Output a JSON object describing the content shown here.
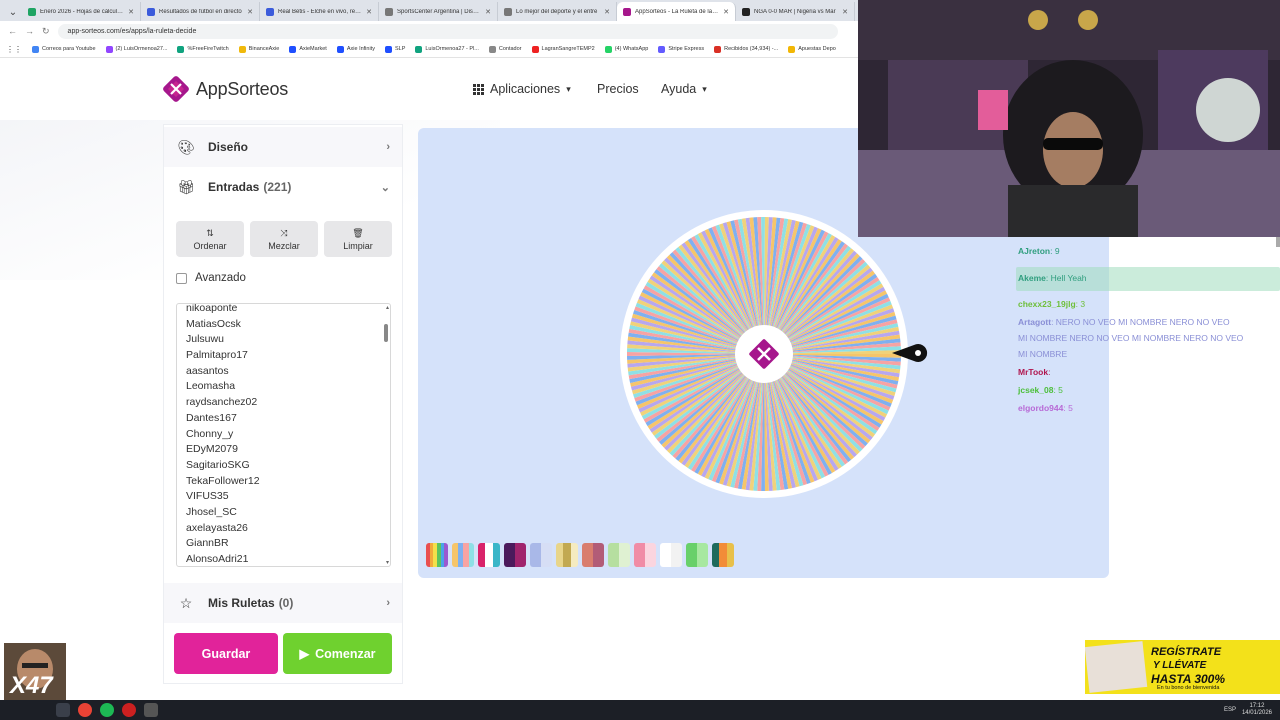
{
  "browser": {
    "tabs": [
      {
        "title": "Enero 2026 - Hojas de cálculo de",
        "color": "#1fa463",
        "active": false
      },
      {
        "title": "Resultados de fútbol en directo",
        "color": "#3b5bdb",
        "active": false
      },
      {
        "title": "Real Betis - Elche en vivo, resulta",
        "color": "#3b5bdb",
        "active": false
      },
      {
        "title": "SportsCenter Argentina | Disney",
        "color": "#777777",
        "active": false
      },
      {
        "title": "Lo mejor del deporte y el entre",
        "color": "#777777",
        "active": false
      },
      {
        "title": "AppSorteos - La Ruleta de la Su",
        "color": "#a6178c",
        "active": true
      },
      {
        "title": "NGA 0-0 MAR | Nigeria vs Mar",
        "color": "#222222",
        "active": false
      }
    ],
    "url": "app-sorteos.com/es/apps/la-ruleta-decide",
    "bookmarks": [
      {
        "label": "Correos para Youtube",
        "color": "#4285f4"
      },
      {
        "label": "(2) LuisOrmenoa27...",
        "color": "#9146ff"
      },
      {
        "label": "%FreeFireTwitch",
        "color": "#10a37f"
      },
      {
        "label": "BinanceAxie",
        "color": "#f0b90b"
      },
      {
        "label": "AxieMarket",
        "color": "#1f4fff"
      },
      {
        "label": "Axie Infinity",
        "color": "#1f4fff"
      },
      {
        "label": "SLP",
        "color": "#1f4fff"
      },
      {
        "label": "LuisOrmenoa27 - Pl...",
        "color": "#10a37f"
      },
      {
        "label": "Contador",
        "color": "#888888"
      },
      {
        "label": "LagranSangreTEMP2",
        "color": "#e22"
      },
      {
        "label": "(4) WhatsApp",
        "color": "#25d366"
      },
      {
        "label": "Stripe Express",
        "color": "#635bff"
      },
      {
        "label": "Recibidos (34,934) -...",
        "color": "#d93025"
      },
      {
        "label": "Apuestas Depo",
        "color": "#f2b705"
      }
    ]
  },
  "header": {
    "logo_text": "AppSorteos",
    "nav": {
      "apps": "Aplicaciones",
      "prices": "Precios",
      "help": "Ayuda"
    }
  },
  "panel": {
    "design_label": "Diseño",
    "entries_label": "Entradas",
    "entries_count": "(221)",
    "buttons": {
      "sort": "Ordenar",
      "shuffle": "Mezclar",
      "clear": "Limpiar"
    },
    "advanced_label": "Avanzado",
    "entries": [
      "nikoaponte",
      "MatiasOcsk",
      "Julsuwu",
      "Palmitapro17",
      "aasantos",
      "Leomasha",
      "raydsanchez02",
      "Dantes167",
      "Chonny_y",
      "EDyM2079",
      "SagitarioSKG",
      "TekaFollower12",
      "VIFUS35",
      "Jhosel_SC",
      "axelayasta26",
      "GiannBR",
      "AlonsoAdri21"
    ],
    "my_wheels_label": "Mis Ruletas",
    "my_wheels_count": "(0)",
    "save_label": "Guardar",
    "start_label": "Comenzar"
  },
  "wheel": {
    "segments": 221,
    "colors": [
      "#f6c56a",
      "#7fb0f0",
      "#f7a3a3",
      "#8ee0e6",
      "#f0d27a",
      "#b7a7ef"
    ]
  },
  "palettes": [
    [
      "#e94f4f",
      "#f2a93b",
      "#f3e04a",
      "#5ec45e",
      "#4aa3e8",
      "#9b59d0"
    ],
    [
      "#f6c56a",
      "#7fb0f0",
      "#f7a3a3",
      "#8ee0e6"
    ],
    [
      "#d9236a",
      "#ffffff",
      "#3bb6c8"
    ],
    [
      "#4b1a5c",
      "#a0246d"
    ],
    [
      "#a9b8e8",
      "#d6def5"
    ],
    [
      "#e8d58a",
      "#c2a951",
      "#f5ebc0"
    ],
    [
      "#d97d6e",
      "#b25c77"
    ],
    [
      "#b6dfa0",
      "#dff1d2"
    ],
    [
      "#f08ca6",
      "#fbd5df"
    ],
    [
      "#ffffff",
      "#f2f2f2"
    ],
    [
      "#68d06a",
      "#a7e8a0"
    ],
    [
      "#1f6b5c",
      "#f28c38",
      "#e8c04a"
    ]
  ],
  "chat": [
    {
      "user": "AJreton",
      "text": ": 9",
      "color": "#2f9e7e"
    },
    {
      "user": "Akeme",
      "text": ": Hell Yeah",
      "color": "#2f9e7e",
      "highlight": true
    },
    {
      "user": "chexx23_19jlg",
      "text": ": 3",
      "color": "#6ebf3a"
    },
    {
      "user": "Artagott",
      "text": ": NERO NO VEO MI NOMBRE NERO NO VEO",
      "color": "#8a8fd6"
    },
    {
      "user": "",
      "text": "MI NOMBRE NERO NO VEO MI NOMBRE NERO NO VEO",
      "color": "#8a8fd6"
    },
    {
      "user": "",
      "text": "MI NOMBRE",
      "color": "#8a8fd6"
    },
    {
      "user": "MrTook",
      "text": ":",
      "color": "#b0164e"
    },
    {
      "user": "jcsek_08",
      "text": ": 5",
      "color": "#4cbf3a"
    },
    {
      "user": "elgordo944",
      "text": ": 5",
      "color": "#b86ad6"
    }
  ],
  "ad": {
    "line1": "REGÍSTRATE",
    "line2": "Y LLÉVATE",
    "line3": "HASTA 300%",
    "line4": "En tu bono de bienvenida"
  },
  "emote_text": "X47",
  "taskbar": {
    "lang": "ESP",
    "time": "17:12",
    "date": "14/01/2026"
  }
}
